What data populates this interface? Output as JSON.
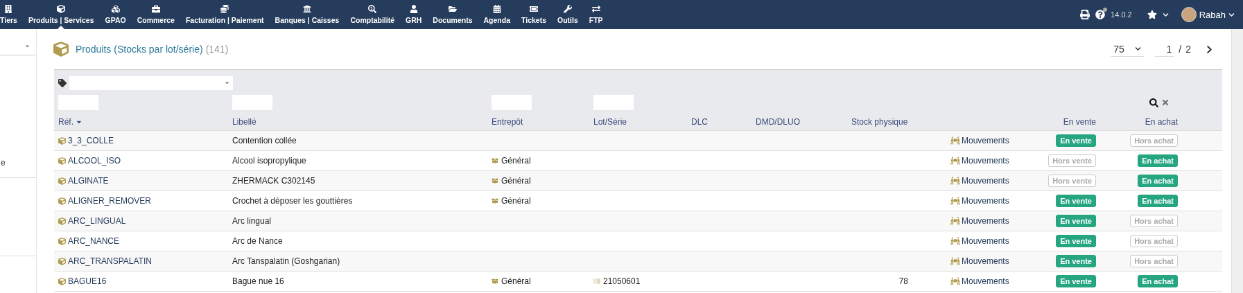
{
  "menu": [
    {
      "label": "Tiers",
      "selected": false
    },
    {
      "label": "Produits | Services",
      "selected": true
    },
    {
      "label": "GPAO",
      "selected": false
    },
    {
      "label": "Commerce",
      "selected": false
    },
    {
      "label": "Facturation | Paiement",
      "selected": false
    },
    {
      "label": "Banques | Caisses",
      "selected": false
    },
    {
      "label": "Comptabilité",
      "selected": false
    },
    {
      "label": "GRH",
      "selected": false
    },
    {
      "label": "Documents",
      "selected": false
    },
    {
      "label": "Agenda",
      "selected": false
    },
    {
      "label": "Tickets",
      "selected": false
    },
    {
      "label": "Outils",
      "selected": false
    },
    {
      "label": "FTP",
      "selected": false
    }
  ],
  "version": "14.0.2",
  "user": {
    "name": "Rabah"
  },
  "sidebar": {
    "fragment": "e"
  },
  "page": {
    "title": "Produits (Stocks par lot/série)",
    "count": "(141)",
    "limit": "75",
    "page": "1",
    "separator": "/",
    "pages": "2"
  },
  "columns": [
    {
      "label": "Réf.",
      "sorted": true
    },
    {
      "label": "Libellé",
      "sorted": false
    },
    {
      "label": "Entrepôt",
      "sorted": false
    },
    {
      "label": "Lot/Série",
      "sorted": false
    },
    {
      "label": "DLC",
      "sorted": false
    },
    {
      "label": "DMD/DLUO",
      "sorted": false
    },
    {
      "label": "Stock physique",
      "sorted": false
    },
    {
      "label": "En vente",
      "sorted": false
    },
    {
      "label": "En achat",
      "sorted": false
    }
  ],
  "rows": [
    {
      "ref": "3_3_COLLE",
      "label": "Contention collée",
      "warehouse": null,
      "lot": null,
      "stock": null,
      "movements": "Mouvements",
      "sale": {
        "label": "En vente",
        "on": true
      },
      "purchase": {
        "label": "Hors achat",
        "on": false
      }
    },
    {
      "ref": "ALCOOL_ISO",
      "label": "Alcool isopropylique",
      "warehouse": "Général",
      "lot": null,
      "stock": null,
      "movements": "Mouvements",
      "sale": {
        "label": "Hors vente",
        "on": false
      },
      "purchase": {
        "label": "En achat",
        "on": true
      }
    },
    {
      "ref": "ALGINATE",
      "label": "ZHERMACK C302145",
      "warehouse": "Général",
      "lot": null,
      "stock": null,
      "movements": "Mouvements",
      "sale": {
        "label": "Hors vente",
        "on": false
      },
      "purchase": {
        "label": "En achat",
        "on": true
      }
    },
    {
      "ref": "ALIGNER_REMOVER",
      "label": "Crochet à déposer les gouttières",
      "warehouse": "Général",
      "lot": null,
      "stock": null,
      "movements": "Mouvements",
      "sale": {
        "label": "En vente",
        "on": true
      },
      "purchase": {
        "label": "En achat",
        "on": true
      }
    },
    {
      "ref": "ARC_LINGUAL",
      "label": "Arc lingual",
      "warehouse": null,
      "lot": null,
      "stock": null,
      "movements": "Mouvements",
      "sale": {
        "label": "En vente",
        "on": true
      },
      "purchase": {
        "label": "Hors achat",
        "on": false
      }
    },
    {
      "ref": "ARC_NANCE",
      "label": "Arc de Nance",
      "warehouse": null,
      "lot": null,
      "stock": null,
      "movements": "Mouvements",
      "sale": {
        "label": "En vente",
        "on": true
      },
      "purchase": {
        "label": "Hors achat",
        "on": false
      }
    },
    {
      "ref": "ARC_TRANSPALATIN",
      "label": "Arc Tanspalatin (Goshgarian)",
      "warehouse": null,
      "lot": null,
      "stock": null,
      "movements": "Mouvements",
      "sale": {
        "label": "En vente",
        "on": true
      },
      "purchase": {
        "label": "Hors achat",
        "on": false
      }
    },
    {
      "ref": "BAGUE16",
      "label": "Bague nue 16",
      "warehouse": "Général",
      "lot": "21050601",
      "stock": "78",
      "movements": "Mouvements",
      "sale": {
        "label": "En vente",
        "on": true
      },
      "purchase": {
        "label": "En achat",
        "on": true
      }
    }
  ]
}
